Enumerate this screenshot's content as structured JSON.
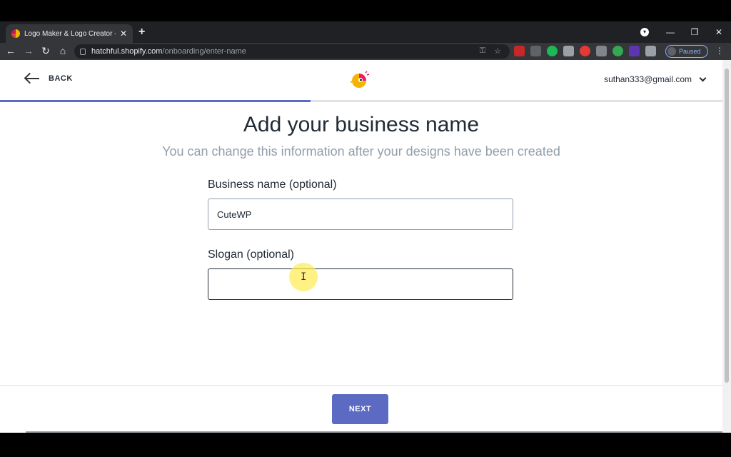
{
  "browser": {
    "tab_title": "Logo Maker & Logo Creator - Fr",
    "new_tab": "+",
    "url_host": "hatchful.shopify.com",
    "url_path": "/onboarding/enter-name",
    "profile_status": "Paused",
    "window_controls": {
      "minimize": "—",
      "restore": "❐",
      "close": "✕"
    },
    "nav": {
      "back": "←",
      "forward": "→",
      "reload": "↻",
      "home": "⌂"
    }
  },
  "header": {
    "back_label": "BACK",
    "account_email": "suthan333@gmail.com"
  },
  "progress": {
    "fraction": 0.43,
    "color": "#5c6ac4"
  },
  "main": {
    "title": "Add your business name",
    "subtitle": "You can change this information after your designs have been created"
  },
  "form": {
    "business_label": "Business name (optional)",
    "business_value": "CuteWP",
    "slogan_label": "Slogan (optional)",
    "slogan_value": ""
  },
  "footer": {
    "next_label": "NEXT"
  },
  "colors": {
    "accent": "#5c6ac4",
    "text": "#212b36",
    "muted": "#919eab"
  }
}
